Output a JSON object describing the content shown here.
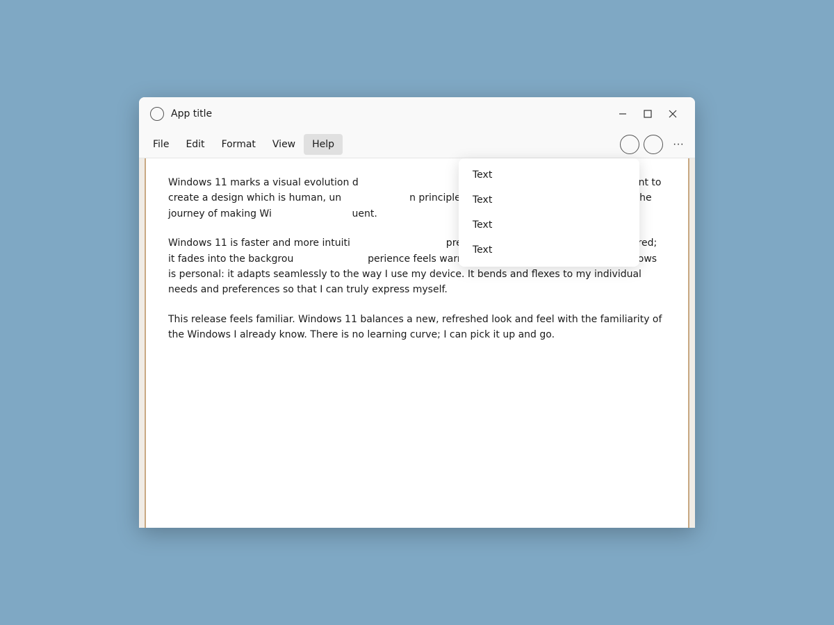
{
  "window": {
    "title": "App title",
    "icon_label": "app-icon"
  },
  "titlebar": {
    "title": "App title",
    "controls": {
      "minimize_label": "—",
      "maximize_label": "□",
      "close_label": "✕"
    }
  },
  "menubar": {
    "items": [
      {
        "id": "file",
        "label": "File"
      },
      {
        "id": "edit",
        "label": "Edit"
      },
      {
        "id": "format",
        "label": "Format"
      },
      {
        "id": "view",
        "label": "View"
      },
      {
        "id": "help",
        "label": "Help"
      }
    ]
  },
  "dropdown": {
    "items": [
      {
        "label": "Text"
      },
      {
        "label": "Text"
      },
      {
        "label": "Text"
      },
      {
        "label": "Text"
      }
    ]
  },
  "content": {
    "paragraphs": [
      "Windows 11 marks a visual evolution d                                     design language alongside with Fluent to create a design which is human, un                                   n principles below have guided us throughout the journey of making Wi                                      uent.",
      "Windows 11 is faster and more intuiti                                    precision. The OS is softer and decluttered; it fades into the backgrou                                   perience feels warm, ethereal and approachable.  Windows is personal: it adapts seamlessly to the way I use my device. It bends and flexes to my individual needs and preferences so that I can truly express myself.",
      "This release feels familiar. Windows 11 balances a new, refreshed look and feel with the familiarity of the Windows I already know. There is no learning curve; I can pick it up and go."
    ]
  }
}
